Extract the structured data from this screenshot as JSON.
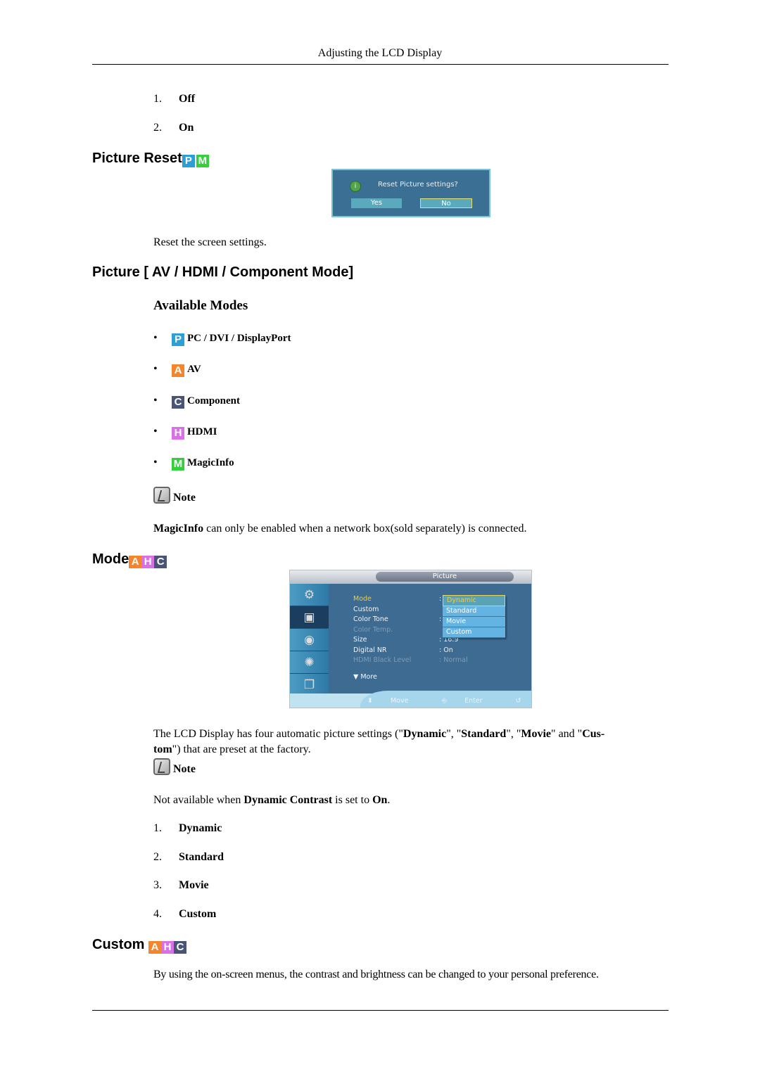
{
  "header": {
    "title": "Adjusting the LCD Display"
  },
  "intro_list": [
    {
      "num": "1.",
      "label": "Off"
    },
    {
      "num": "2.",
      "label": "On"
    }
  ],
  "picture_reset": {
    "heading": "Picture Reset",
    "badges": [
      "P",
      "M"
    ],
    "dialog": {
      "icon": "info-icon",
      "message": "Reset Picture settings?",
      "yes_label": "Yes",
      "no_label": "No"
    },
    "description": "Reset the screen settings."
  },
  "picture_modes": {
    "heading": "Picture [ AV / HDMI / Component Mode]",
    "subheading": "Available Modes",
    "modes": [
      {
        "badge": "P",
        "label": "PC / DVI / DisplayPort"
      },
      {
        "badge": "A",
        "label": "AV"
      },
      {
        "badge": "C",
        "label": "Component"
      },
      {
        "badge": "H",
        "label": "HDMI"
      },
      {
        "badge": "M",
        "label": "MagicInfo"
      }
    ],
    "note_label": "Note",
    "note_bold": "MagicInfo",
    "note_text": " can only be enabled when a network box(sold separately) is connected."
  },
  "mode": {
    "heading": "Mode",
    "badges": [
      "A",
      "H",
      "C"
    ],
    "osd": {
      "title": "Picture",
      "sidebar_icons": [
        "input-icon",
        "picture-icon",
        "sound-icon",
        "setup-icon",
        "multi-control-icon"
      ],
      "rows": [
        {
          "label": "Mode",
          "value": ":",
          "state": "highlight"
        },
        {
          "label": "Custom",
          "value": "",
          "state": "normal"
        },
        {
          "label": "Color Tone",
          "value": ":",
          "state": "normal"
        },
        {
          "label": "Color Temp.",
          "value": "",
          "state": "dim"
        },
        {
          "label": "Size",
          "value": ": 16:9",
          "state": "normal"
        },
        {
          "label": "Digital NR",
          "value": ": On",
          "state": "normal"
        },
        {
          "label": "HDMI Black Level",
          "value": ": Normal",
          "state": "dim"
        }
      ],
      "dropdown": [
        "Dynamic",
        "Standard",
        "Movie",
        "Custom"
      ],
      "dropdown_selected": "Dynamic",
      "more_label": "More",
      "footer": [
        "Move",
        "Enter",
        "Return"
      ]
    },
    "desc_parts": {
      "p1": "The LCD Display has four automatic picture settings (\"",
      "b1": "Dynamic",
      "p2": "\", \"",
      "b2": "Standard",
      "p3": "\", \"",
      "b3": "Movie",
      "p4": "\" and \"",
      "b4": "Cus-",
      "b5": "tom",
      "p5": "\") that are preset at the factory."
    },
    "note_label": "Note",
    "note_parts": {
      "p1": "Not available when ",
      "b1": "Dynamic Contrast",
      "p2": " is set to ",
      "b2": "On",
      "p3": "."
    },
    "list": [
      {
        "num": "1.",
        "label": "Dynamic"
      },
      {
        "num": "2.",
        "label": "Standard"
      },
      {
        "num": "3.",
        "label": "Movie"
      },
      {
        "num": "4.",
        "label": "Custom"
      }
    ]
  },
  "custom": {
    "heading": "Custom",
    "badges": [
      "A",
      "H",
      "C"
    ],
    "description": "By using the on-screen menus, the contrast and brightness can be changed to your personal preference."
  },
  "colors": {
    "badge_p": "#2b9fd6",
    "badge_m": "#35cf3c",
    "badge_a": "#f5852b",
    "badge_h": "#d970e8",
    "badge_c": "#4a5575",
    "osd_bg": "#3d6b92",
    "osd_highlight": "#f4c93d"
  }
}
